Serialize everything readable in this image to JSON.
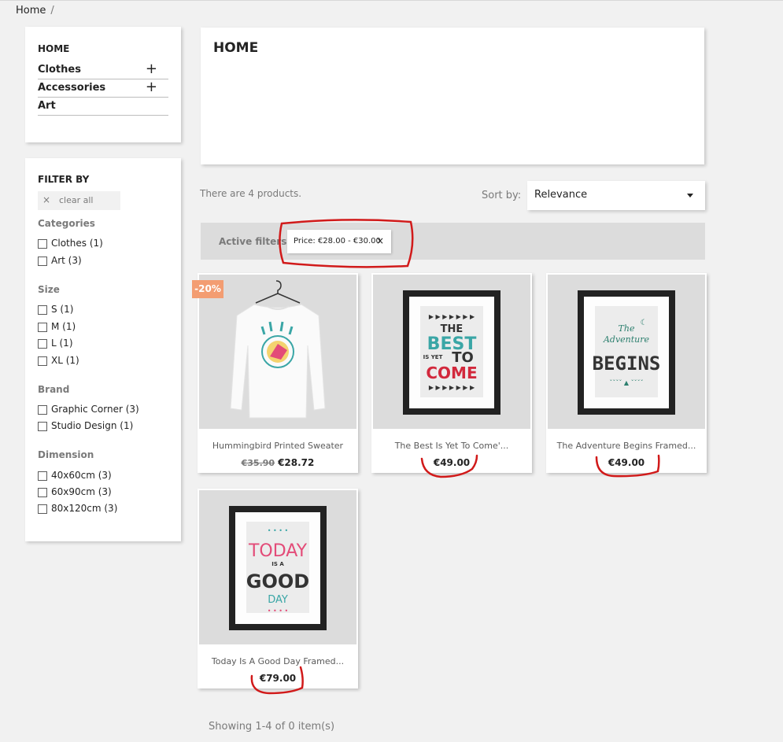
{
  "breadcrumb": {
    "home": "Home",
    "separator": "/"
  },
  "category_menu": {
    "title": "HOME",
    "items": [
      {
        "label": "Clothes",
        "expand": "+"
      },
      {
        "label": "Accessories",
        "expand": "+"
      },
      {
        "label": "Art"
      }
    ]
  },
  "filters": {
    "title": "FILTER BY",
    "clear_all": "clear all",
    "clear_icon": "×",
    "groups": [
      {
        "title": "Categories",
        "options": [
          "Clothes (1)",
          "Art (3)"
        ]
      },
      {
        "title": "Size",
        "options": [
          "S (1)",
          "M (1)",
          "L (1)",
          "XL (1)"
        ]
      },
      {
        "title": "Brand",
        "options": [
          "Graphic Corner (3)",
          "Studio Design (1)"
        ]
      },
      {
        "title": "Dimension",
        "options": [
          "40x60cm (3)",
          "60x90cm (3)",
          "80x120cm (3)"
        ]
      }
    ]
  },
  "header": {
    "title": "HOME"
  },
  "listing": {
    "count_text": "There are 4 products.",
    "sort_label": "Sort by:",
    "sort_value": "Relevance",
    "active_filters_label": "Active filters",
    "active_filter_chip": "Price: €28.00 - €30.00",
    "chip_remove": "×",
    "showing": "Showing 1-4 of 0 item(s)"
  },
  "products": [
    {
      "name": "Hummingbird Printed Sweater",
      "old_price": "€35.90",
      "price": "€28.72",
      "badge": "-20%"
    },
    {
      "name": "The Best Is Yet To Come'...",
      "price": "€49.00"
    },
    {
      "name": "The Adventure Begins Framed...",
      "price": "€49.00"
    },
    {
      "name": "Today Is A Good Day Framed...",
      "price": "€79.00"
    }
  ],
  "poster_text": {
    "best": {
      "line1": "THE",
      "line2": "BEST",
      "line3": "IS YET",
      "line4": "TO",
      "line5": "COME"
    },
    "adventure": {
      "line1": "The",
      "line2": "Adventure",
      "line3": "BEGINS"
    },
    "today": {
      "line1": "TODAY",
      "line2": "IS A",
      "line3": "GOOD",
      "line4": "DAY"
    }
  },
  "colors": {
    "annotation": "#d11a1a",
    "badge": "#f39d72",
    "accent_teal": "#3aa6a6",
    "accent_red": "#d2283c",
    "accent_pink": "#e34b78"
  }
}
